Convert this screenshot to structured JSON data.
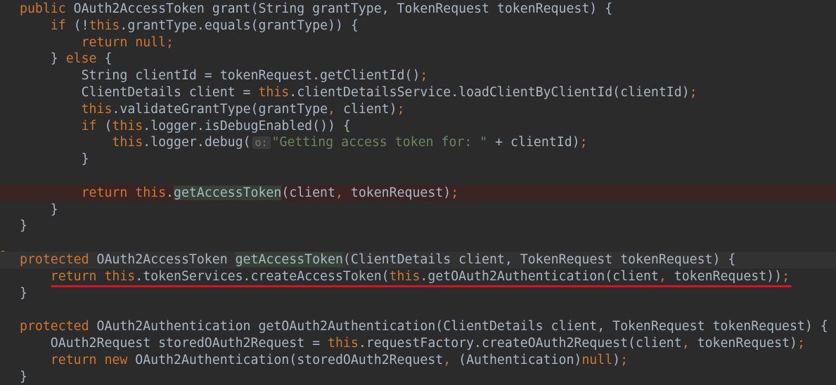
{
  "editor": {
    "lines": [
      {
        "segments": [
          {
            "t": "public ",
            "c": "kw"
          },
          {
            "t": "OAuth2AccessToken grant(String grantType, TokenRequest tokenRequest) {",
            "c": "ident"
          }
        ]
      },
      {
        "segments": [
          {
            "t": "    if ",
            "c": "kw"
          },
          {
            "t": "(!",
            "c": "ident"
          },
          {
            "t": "this",
            "c": "kw"
          },
          {
            "t": ".grantType.equals(grantType)) {",
            "c": "ident"
          }
        ]
      },
      {
        "segments": [
          {
            "t": "        return null;",
            "c": "kw"
          }
        ]
      },
      {
        "segments": [
          {
            "t": "    } ",
            "c": "ident"
          },
          {
            "t": "else ",
            "c": "kw"
          },
          {
            "t": "{",
            "c": "ident"
          }
        ]
      },
      {
        "segments": [
          {
            "t": "        String clientId = tokenRequest.getClientId()",
            "c": "ident"
          },
          {
            "t": ";",
            "c": "kw"
          }
        ]
      },
      {
        "segments": [
          {
            "t": "        ClientDetails client = ",
            "c": "ident"
          },
          {
            "t": "this",
            "c": "kw"
          },
          {
            "t": ".clientDetailsService.loadClientByClientId(clientId)",
            "c": "ident"
          },
          {
            "t": ";",
            "c": "kw"
          }
        ]
      },
      {
        "segments": [
          {
            "t": "        ",
            "c": "ident"
          },
          {
            "t": "this",
            "c": "kw"
          },
          {
            "t": ".validateGrantType(grantType",
            "c": "ident"
          },
          {
            "t": ", ",
            "c": "kw"
          },
          {
            "t": "client)",
            "c": "ident"
          },
          {
            "t": ";",
            "c": "kw"
          }
        ]
      },
      {
        "segments": [
          {
            "t": "        if ",
            "c": "kw"
          },
          {
            "t": "(",
            "c": "ident"
          },
          {
            "t": "this",
            "c": "kw"
          },
          {
            "t": ".logger.isDebugEnabled()) {",
            "c": "ident"
          }
        ]
      },
      {
        "segments": [
          {
            "t": "            ",
            "c": "ident"
          },
          {
            "t": "this",
            "c": "kw"
          },
          {
            "t": ".logger.debug(",
            "c": "ident"
          },
          {
            "t": "o:",
            "c": "hint"
          },
          {
            "t": "\"Getting access token for: \"",
            "c": "str"
          },
          {
            "t": " + clientId)",
            "c": "ident"
          },
          {
            "t": ";",
            "c": "kw"
          }
        ]
      },
      {
        "segments": [
          {
            "t": "        }",
            "c": "ident"
          }
        ]
      },
      {
        "segments": [
          {
            "t": "",
            "c": "ident"
          }
        ]
      },
      {
        "breakpoint": true,
        "segments": [
          {
            "t": "        return this",
            "c": "kw"
          },
          {
            "t": ".",
            "c": "ident"
          },
          {
            "t": "getAccessToken",
            "c": "hl"
          },
          {
            "t": "(client",
            "c": "ident"
          },
          {
            "t": ", ",
            "c": "kw"
          },
          {
            "t": "tokenRequest)",
            "c": "ident"
          },
          {
            "t": ";",
            "c": "kw"
          }
        ]
      },
      {
        "segments": [
          {
            "t": "    }",
            "c": "ident"
          }
        ]
      },
      {
        "segments": [
          {
            "t": "}",
            "c": "ident"
          }
        ]
      },
      {
        "segments": [
          {
            "t": "",
            "c": "ident"
          }
        ]
      },
      {
        "caret": true,
        "segments": [
          {
            "t": "protected ",
            "c": "kw"
          },
          {
            "t": "OAuth2AccessToken ",
            "c": "ident"
          },
          {
            "t": "getAccessToken",
            "c": "hl"
          },
          {
            "t": "(ClientDetails client, TokenRequest tokenRequest) {",
            "c": "ident"
          }
        ]
      },
      {
        "segments": [
          {
            "t": "    return this",
            "c": "kw"
          },
          {
            "t": ".tokenServices.createAccessToken(",
            "c": "ident"
          },
          {
            "t": "this",
            "c": "kw"
          },
          {
            "t": ".getOAuth2Authentication(client",
            "c": "ident"
          },
          {
            "t": ", ",
            "c": "kw"
          },
          {
            "t": "tokenRequest))",
            "c": "ident"
          },
          {
            "t": ";",
            "c": "kw"
          }
        ]
      },
      {
        "segments": [
          {
            "t": "}",
            "c": "ident"
          }
        ]
      },
      {
        "segments": [
          {
            "t": "",
            "c": "ident"
          }
        ]
      },
      {
        "segments": [
          {
            "t": "protected ",
            "c": "kw"
          },
          {
            "t": "OAuth2Authentication getOAuth2Authentication(ClientDetails client, TokenRequest tokenRequest) {",
            "c": "ident"
          }
        ]
      },
      {
        "segments": [
          {
            "t": "    OAuth2Request storedOAuth2Request = ",
            "c": "ident"
          },
          {
            "t": "this",
            "c": "kw"
          },
          {
            "t": ".requestFactory.createOAuth2Request(client",
            "c": "ident"
          },
          {
            "t": ", ",
            "c": "kw"
          },
          {
            "t": "tokenRequest)",
            "c": "ident"
          },
          {
            "t": ";",
            "c": "kw"
          }
        ]
      },
      {
        "segments": [
          {
            "t": "    return new ",
            "c": "kw"
          },
          {
            "t": "OAuth2Authentication(storedOAuth2Request",
            "c": "ident"
          },
          {
            "t": ", ",
            "c": "kw"
          },
          {
            "t": "(Authentication)",
            "c": "ident"
          },
          {
            "t": "null",
            "c": "kw"
          },
          {
            "t": ")",
            "c": "ident"
          },
          {
            "t": ";",
            "c": "kw"
          }
        ]
      },
      {
        "segments": [
          {
            "t": "}",
            "c": "ident"
          }
        ]
      }
    ]
  },
  "colors": {
    "background": "#2b2b2b",
    "keyword": "#cc7832",
    "string": "#6a8759",
    "identifier": "#a9b7c6",
    "annotation_underline": "#e01020"
  },
  "icons": {
    "gutter": "lightbulb-icon"
  }
}
